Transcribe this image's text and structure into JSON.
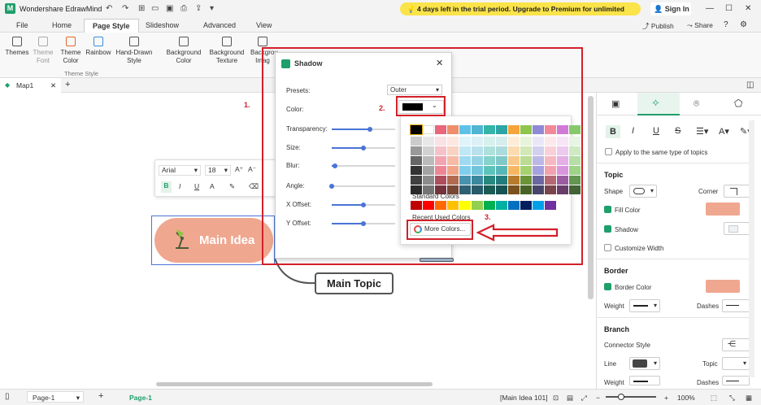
{
  "app": {
    "title": "Wondershare EdrawMind",
    "logo_letter": "M"
  },
  "trial_banner": "4 days left in the trial period. Upgrade to Premium for unlimited access.",
  "sign_in": "Sign In",
  "menu_tabs": [
    "File",
    "Home",
    "Page Style",
    "Slideshow",
    "Advanced",
    "View"
  ],
  "active_menu_tab": "Page Style",
  "publish": "Publish",
  "share": "Share",
  "ribbon": {
    "buttons": [
      "Themes",
      "Theme Font",
      "Theme Color",
      "Rainbow",
      "Hand-Drawn Style",
      "Background Color",
      "Background Texture",
      "Backgrou Imag"
    ],
    "group_label": "Theme Style"
  },
  "doc_tab": "Map1",
  "float_toolbar": {
    "font": "Arial",
    "size": "18",
    "bold": "B",
    "italic": "I",
    "underline": "U",
    "font_color": "A"
  },
  "canvas": {
    "main_idea": "Main Idea",
    "main_topic": "Main Topic"
  },
  "shadow_dialog": {
    "title": "Shadow",
    "presets_label": "Presets:",
    "presets_value": "Outer",
    "color_label": "Color:",
    "selected_color": "#000000",
    "rows": [
      {
        "label": "Transparency:",
        "value": 0.6
      },
      {
        "label": "Size:",
        "value": 0.5
      },
      {
        "label": "Blur:",
        "value": 0.05
      },
      {
        "label": "Angle:",
        "value": 0.0
      },
      {
        "label": "X Offset:",
        "value": 0.5
      },
      {
        "label": "Y Offset:",
        "value": 0.5
      }
    ]
  },
  "palette": {
    "theme_top": [
      "#000000",
      "#ffffff",
      "#e8677a",
      "#ee8e6a",
      "#5ec2e8",
      "#4fb5d2",
      "#34b5a8",
      "#2da5a5",
      "#f5a43a",
      "#8ec54a",
      "#8f89d6",
      "#f08a9a",
      "#d07ad6",
      "#86c86a"
    ],
    "standard_label": "Standard Colors",
    "standard": [
      "#c00000",
      "#ff0000",
      "#ff6a00",
      "#ffc000",
      "#ffff00",
      "#92d050",
      "#00b050",
      "#00b0a0",
      "#0070c0",
      "#002060",
      "#00a0e9",
      "#7030a0"
    ],
    "recent_label": "Recent Used Colors",
    "more_colors": "More Colors..."
  },
  "annotations": [
    "1.",
    "2.",
    "3."
  ],
  "right_panel": {
    "format_buttons": [
      "B",
      "I",
      "U",
      "S"
    ],
    "apply_same": "Apply to the same type of topics",
    "topic_header": "Topic",
    "shape_label": "Shape",
    "corner_label": "Corner",
    "fill_color_label": "Fill Color",
    "fill_color": "#f0a78f",
    "shadow_label": "Shadow",
    "customize_width": "Customize Width",
    "border_header": "Border",
    "border_color_label": "Border Color",
    "border_color": "#f0a78f",
    "weight_label": "Weight",
    "dashes_label": "Dashes",
    "branch_header": "Branch",
    "connector_style": "Connector Style",
    "line_label": "Line",
    "line_color": "#444444",
    "topic_label": "Topic",
    "weight2_label": "Weight",
    "dashes2_label": "Dashes"
  },
  "status": {
    "page": "Page-1",
    "page_tab": "Page-1",
    "selection": "[Main Idea 101]",
    "zoom": "100%"
  }
}
